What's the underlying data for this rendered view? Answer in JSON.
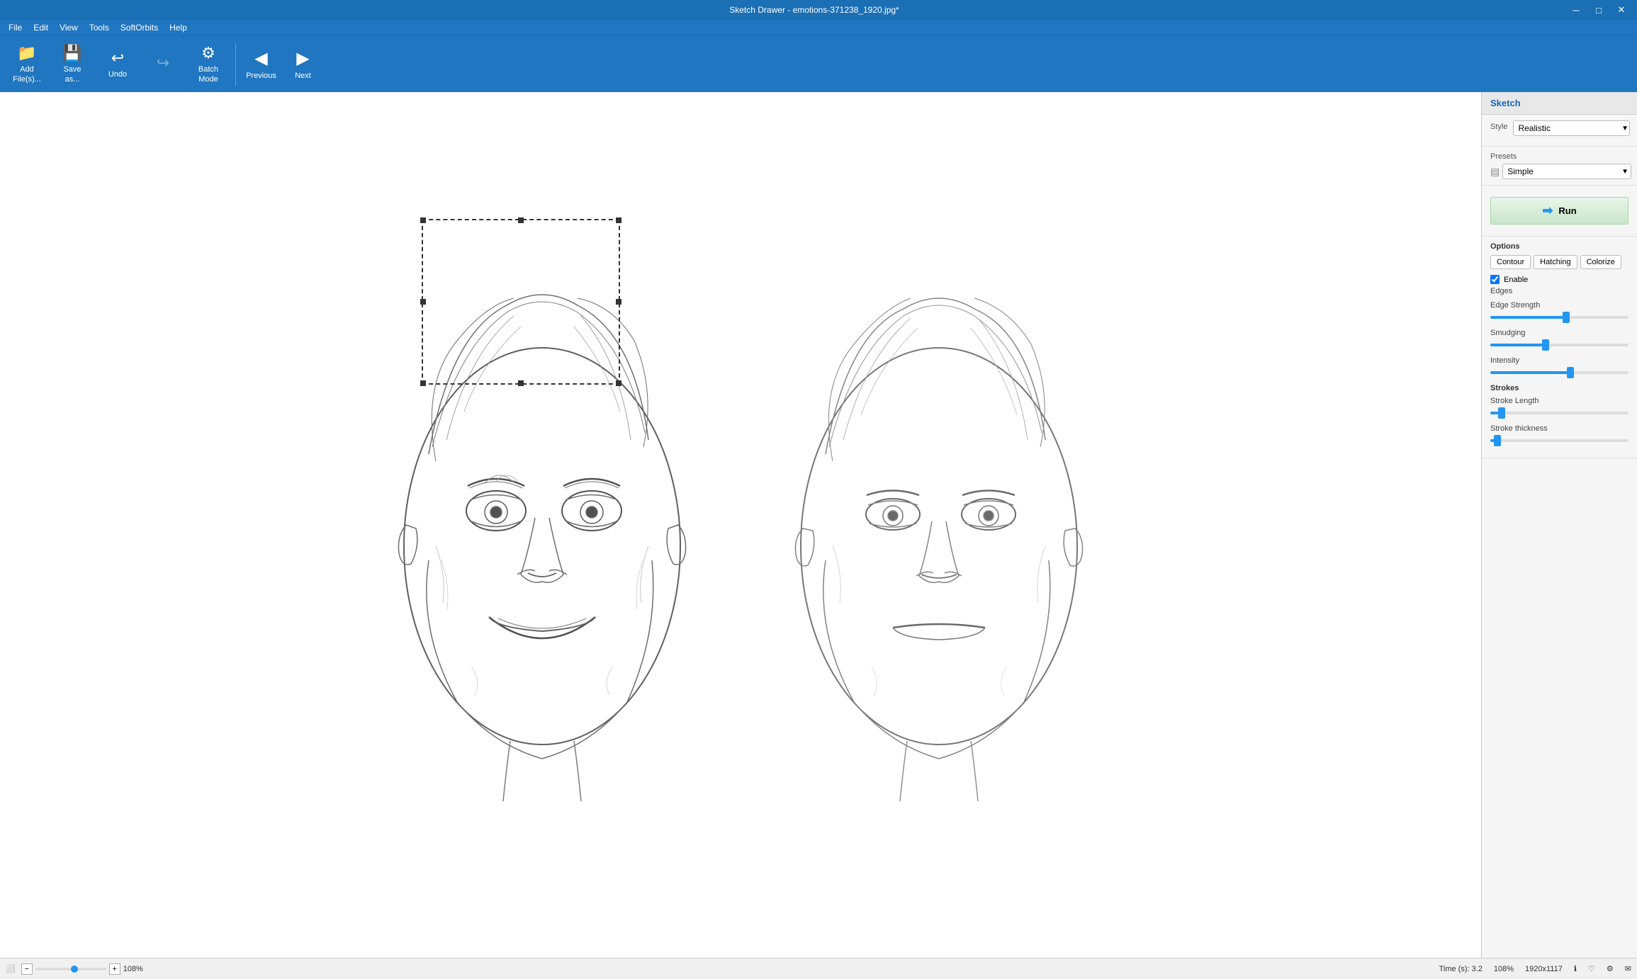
{
  "titleBar": {
    "title": "Sketch Drawer - emotions-371238_1920.jpg*",
    "minimizeLabel": "─",
    "maximizeLabel": "□",
    "closeLabel": "✕"
  },
  "menuBar": {
    "items": [
      "File",
      "Edit",
      "View",
      "Tools",
      "SoftOrbits",
      "Help"
    ]
  },
  "toolbar": {
    "addFilesLabel": "Add\nFile(s)...",
    "saveAsLabel": "Save\nas...",
    "undoLabel": "Undo",
    "redoLabel": "",
    "batchModeLabel": "Batch\nMode",
    "previousLabel": "Previous",
    "nextLabel": "Next"
  },
  "rightPanel": {
    "sketchLabel": "Sketch",
    "styleLabel": "Style",
    "styleValue": "Realistic",
    "presetsLabel": "Presets",
    "presetsValue": "Simple",
    "runLabel": "Run",
    "optionsLabel": "Options",
    "tabs": [
      "Contour",
      "Hatching",
      "Colorize"
    ],
    "enableEdgesLabel": "Enable\nEdges",
    "edgeStrengthLabel": "Edge Strength",
    "edgeStrengthValue": 55,
    "smudgingLabel": "Smudging",
    "smudgingValue": 40,
    "intensityLabel": "Intensity",
    "intensityValue": 58,
    "strokesLabel": "Strokes",
    "strokeLengthLabel": "Stroke Length",
    "strokeLengthValue": 8,
    "strokeThicknessLabel": "Stroke thickness",
    "strokeThicknessValue": 5
  },
  "statusBar": {
    "pageIcon": "⬜",
    "zoomMinus": "−",
    "zoomPlus": "+",
    "zoomPercent": "108%",
    "timeLabel": "Time (s): 3.2",
    "zoomRight": "108%",
    "resolution": "1920x1117",
    "icons": [
      "ℹ",
      "♡",
      "⚙",
      "✉"
    ]
  }
}
